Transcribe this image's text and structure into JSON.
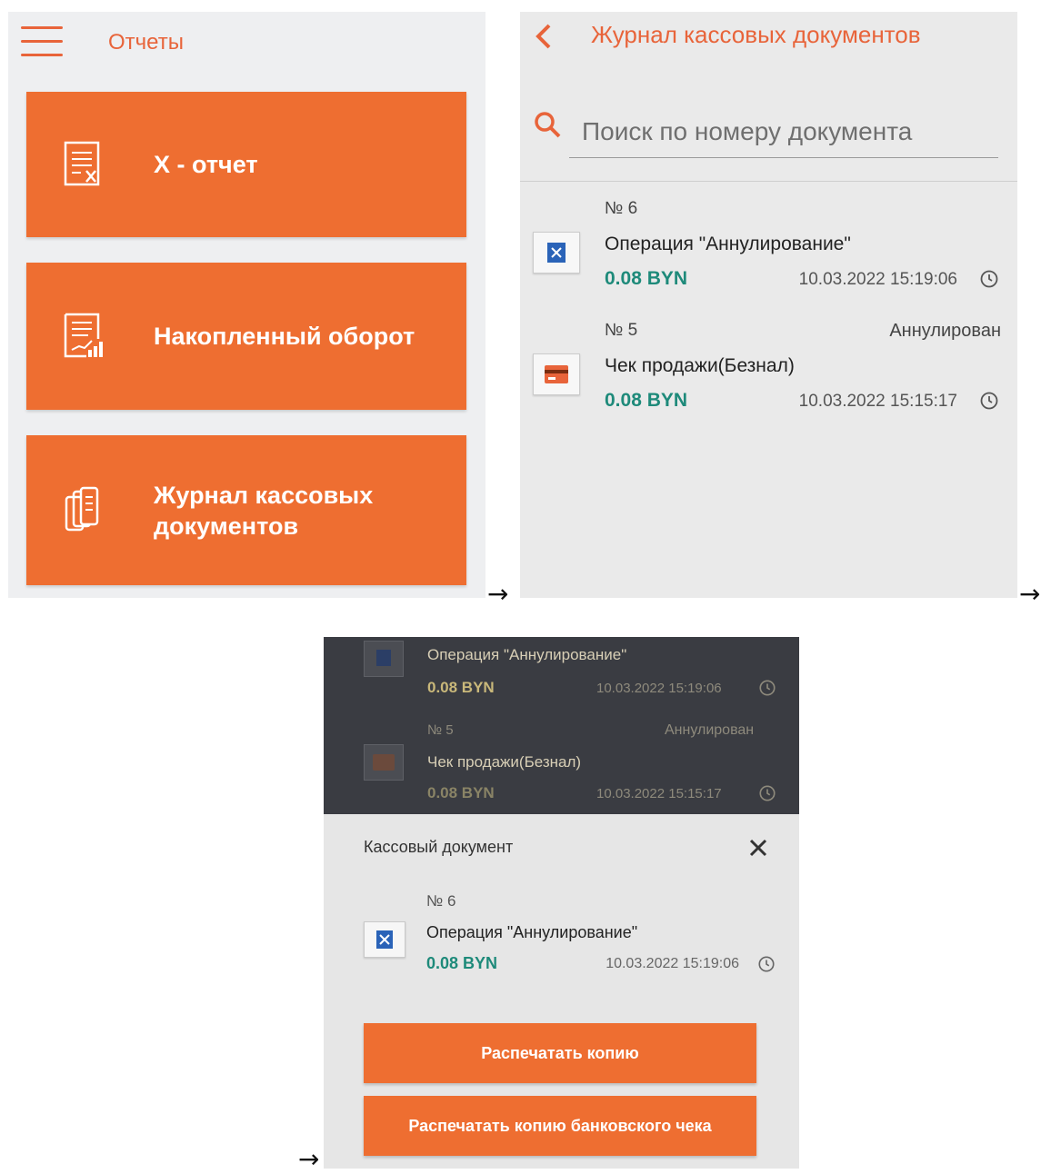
{
  "flow": {
    "arrow": "→"
  },
  "screen1": {
    "title": "Отчеты",
    "tiles": [
      {
        "label": "X - отчет",
        "icon": "document-x-icon"
      },
      {
        "label": "Накопленный оборот",
        "icon": "report-chart-icon"
      },
      {
        "label_line1": "Журнал кассовых",
        "label_line2": "документов",
        "icon": "documents-stack-icon"
      }
    ],
    "colors": {
      "accent": "#ee6e31",
      "header_text": "#e8643a",
      "background": "#eeeff1"
    }
  },
  "screen2": {
    "title": "Журнал кассовых документов",
    "search": {
      "placeholder": "Поиск по номеру документа",
      "value": ""
    },
    "documents": [
      {
        "number": "№ 6",
        "status": "",
        "operation": "Операция \"Аннулирование\"",
        "amount": "0.08 BYN",
        "datetime": "10.03.2022 15:19:06",
        "icon": "cancel-doc-icon"
      },
      {
        "number": "№ 5",
        "status": "Аннулирован",
        "operation": "Чек продажи(Безнал)",
        "amount": "0.08 BYN",
        "datetime": "10.03.2022 15:15:17",
        "icon": "card-icon"
      }
    ],
    "colors": {
      "amount": "#1e8a7a"
    }
  },
  "screen3": {
    "background_list": [
      {
        "operation": "Операция \"Аннулирование\"",
        "amount": "0.08 BYN",
        "datetime": "10.03.2022 15:19:06"
      },
      {
        "number": "№ 5",
        "status": "Аннулирован",
        "operation": "Чек продажи(Безнал)",
        "amount": "0.08 BYN",
        "datetime": "10.03.2022 15:15:17"
      }
    ],
    "sheet": {
      "title": "Кассовый документ",
      "document": {
        "number": "№ 6",
        "operation": "Операция \"Аннулирование\"",
        "amount": "0.08 BYN",
        "datetime": "10.03.2022 15:19:06"
      },
      "buttons": {
        "print_copy": "Распечатать копию",
        "print_bank_copy": "Распечатать копию банковского чека"
      }
    }
  }
}
